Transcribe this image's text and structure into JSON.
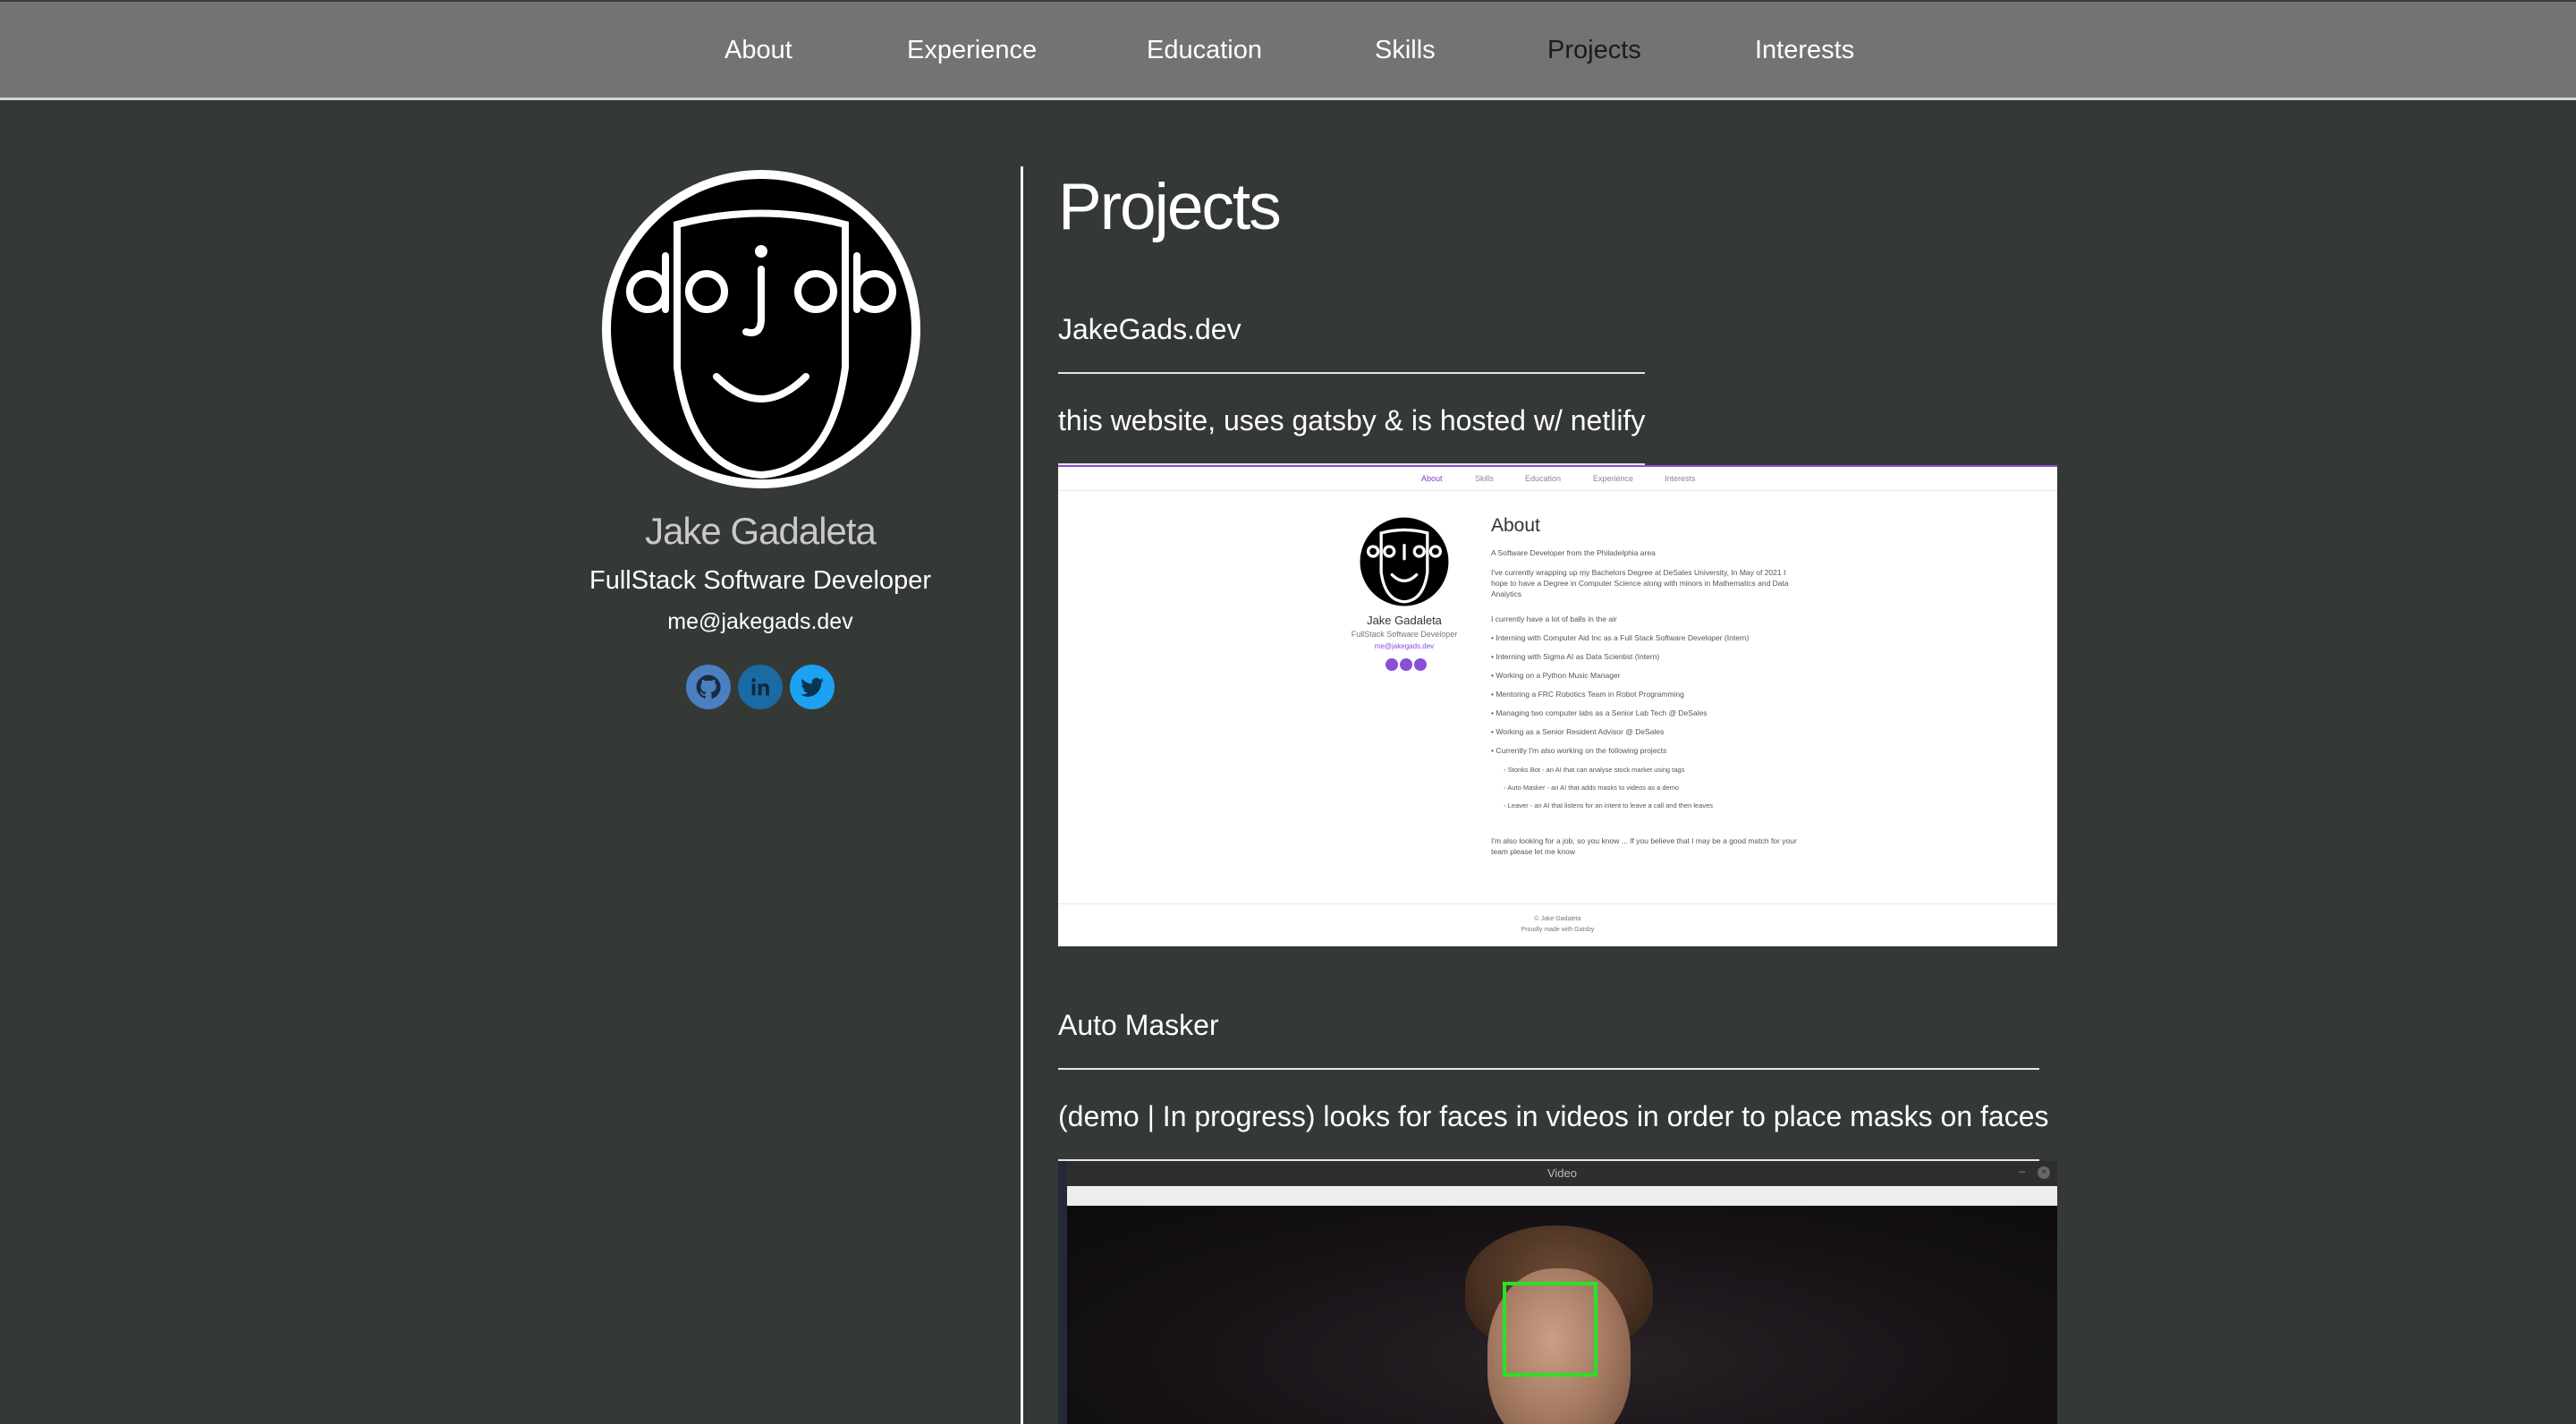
{
  "nav": {
    "items": [
      {
        "label": "About"
      },
      {
        "label": "Experience"
      },
      {
        "label": "Education"
      },
      {
        "label": "Skills"
      },
      {
        "label": "Projects",
        "active": true
      },
      {
        "label": "Interests"
      }
    ]
  },
  "profile": {
    "name": "Jake Gadaleta",
    "role": "FullStack Software Developer",
    "email": "me@jakegads.dev",
    "social": [
      {
        "icon": "github-icon"
      },
      {
        "icon": "linkedin-icon"
      },
      {
        "icon": "twitter-icon"
      }
    ]
  },
  "main": {
    "section_title": "Projects",
    "projects": [
      {
        "title": "JakeGads.dev",
        "description": "this website, uses gatsby & is hosted w/ netlify",
        "preview": {
          "nav": [
            "About",
            "Skills",
            "Education",
            "Experience",
            "Interests"
          ],
          "name": "Jake Gadaleta",
          "role": "FullStack Software Developer",
          "email": "me@jakegads.dev",
          "heading": "About",
          "intro": "A Software Developer from the Philadelphia area",
          "paragraph": "I've currently wrapping up my Bachelors Degree at DeSales University, In May of 2021 I hope to have a Degree in Computer Science along with minors in Mathematics and Data Analytics",
          "balls_intro": "I currently have a lot of balls in the air",
          "list": [
            "Interning with Computer Aid Inc as a Full Stack Software Developer (Intern)",
            "Interning with Sigma AI as Data Scientist (Intern)",
            "Working on a Python Music Manager",
            "Mentoring a FRC Robotics Team in Robot Programming",
            "Managing two computer labs as a Senior Lab Tech @ DeSales",
            "Working as a Senior Resident Advisor @ DeSales",
            "Currently I'm also working on the following projects"
          ],
          "sublist": [
            "Stonks Bot - an AI that can analyse stock market using tags",
            "Auto Masker - an AI that adds masks to videos as a demo",
            "Leaver - an AI that listens for an intent to leave a call and then leaves"
          ],
          "closing": "I'm also looking for a job, so you know ... If you believe that I may be a good match for your team please let me know",
          "footer_1": "© Jake Gadaleta",
          "footer_2": "Proudly made with Gatsby"
        }
      },
      {
        "title": "Auto Masker",
        "description": "(demo | In progress) looks for faces in videos in order to place masks on faces",
        "preview": {
          "window_title": "Video"
        }
      }
    ]
  },
  "colors": {
    "background": "#353935",
    "nav_background": "#737373",
    "accent_purple": "#8a4fd6",
    "detection_box": "#27e227"
  }
}
